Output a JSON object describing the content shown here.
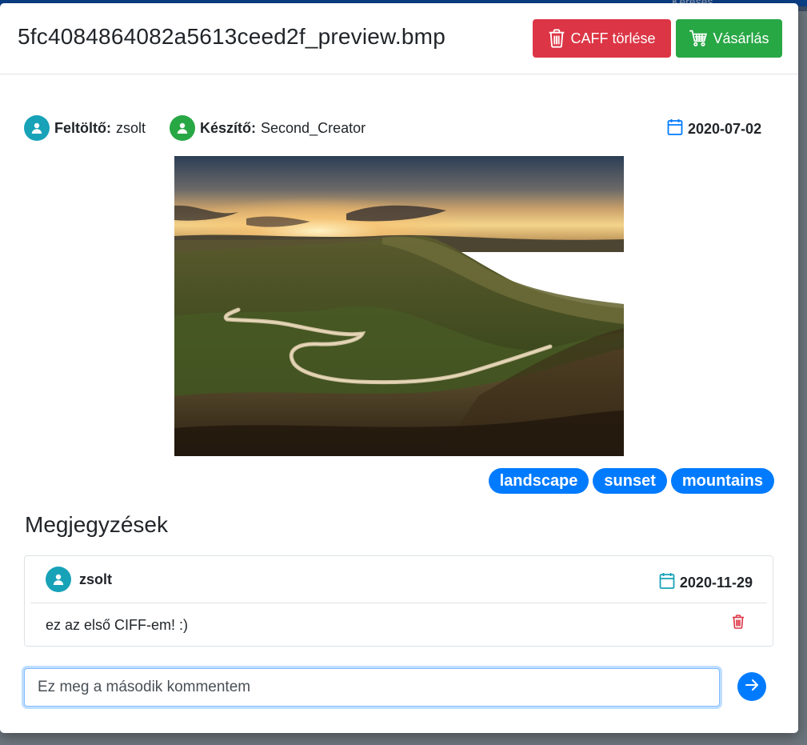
{
  "header": {
    "title": "5fc4084864082a5613ceed2f_preview.bmp",
    "delete_label": "CAFF törlése",
    "buy_label": "Vásárlás"
  },
  "backdrop": {
    "search_label": "Keresés"
  },
  "meta": {
    "uploader_label": "Feltöltő:",
    "uploader_value": "zsolt",
    "creator_label": "Készítő:",
    "creator_value": "Second_Creator",
    "date": "2020-07-02"
  },
  "tags": [
    "landscape",
    "sunset",
    "mountains"
  ],
  "comments_section": {
    "title": "Megjegyzések",
    "comments": [
      {
        "author": "zsolt",
        "date": "2020-11-29",
        "text": "ez az első CIFF-em! :)"
      }
    ],
    "input_value": "Ez meg a második kommentem"
  },
  "colors": {
    "primary": "#007bff",
    "danger": "#dc3545",
    "success": "#28a745",
    "info": "#17a2b8"
  }
}
